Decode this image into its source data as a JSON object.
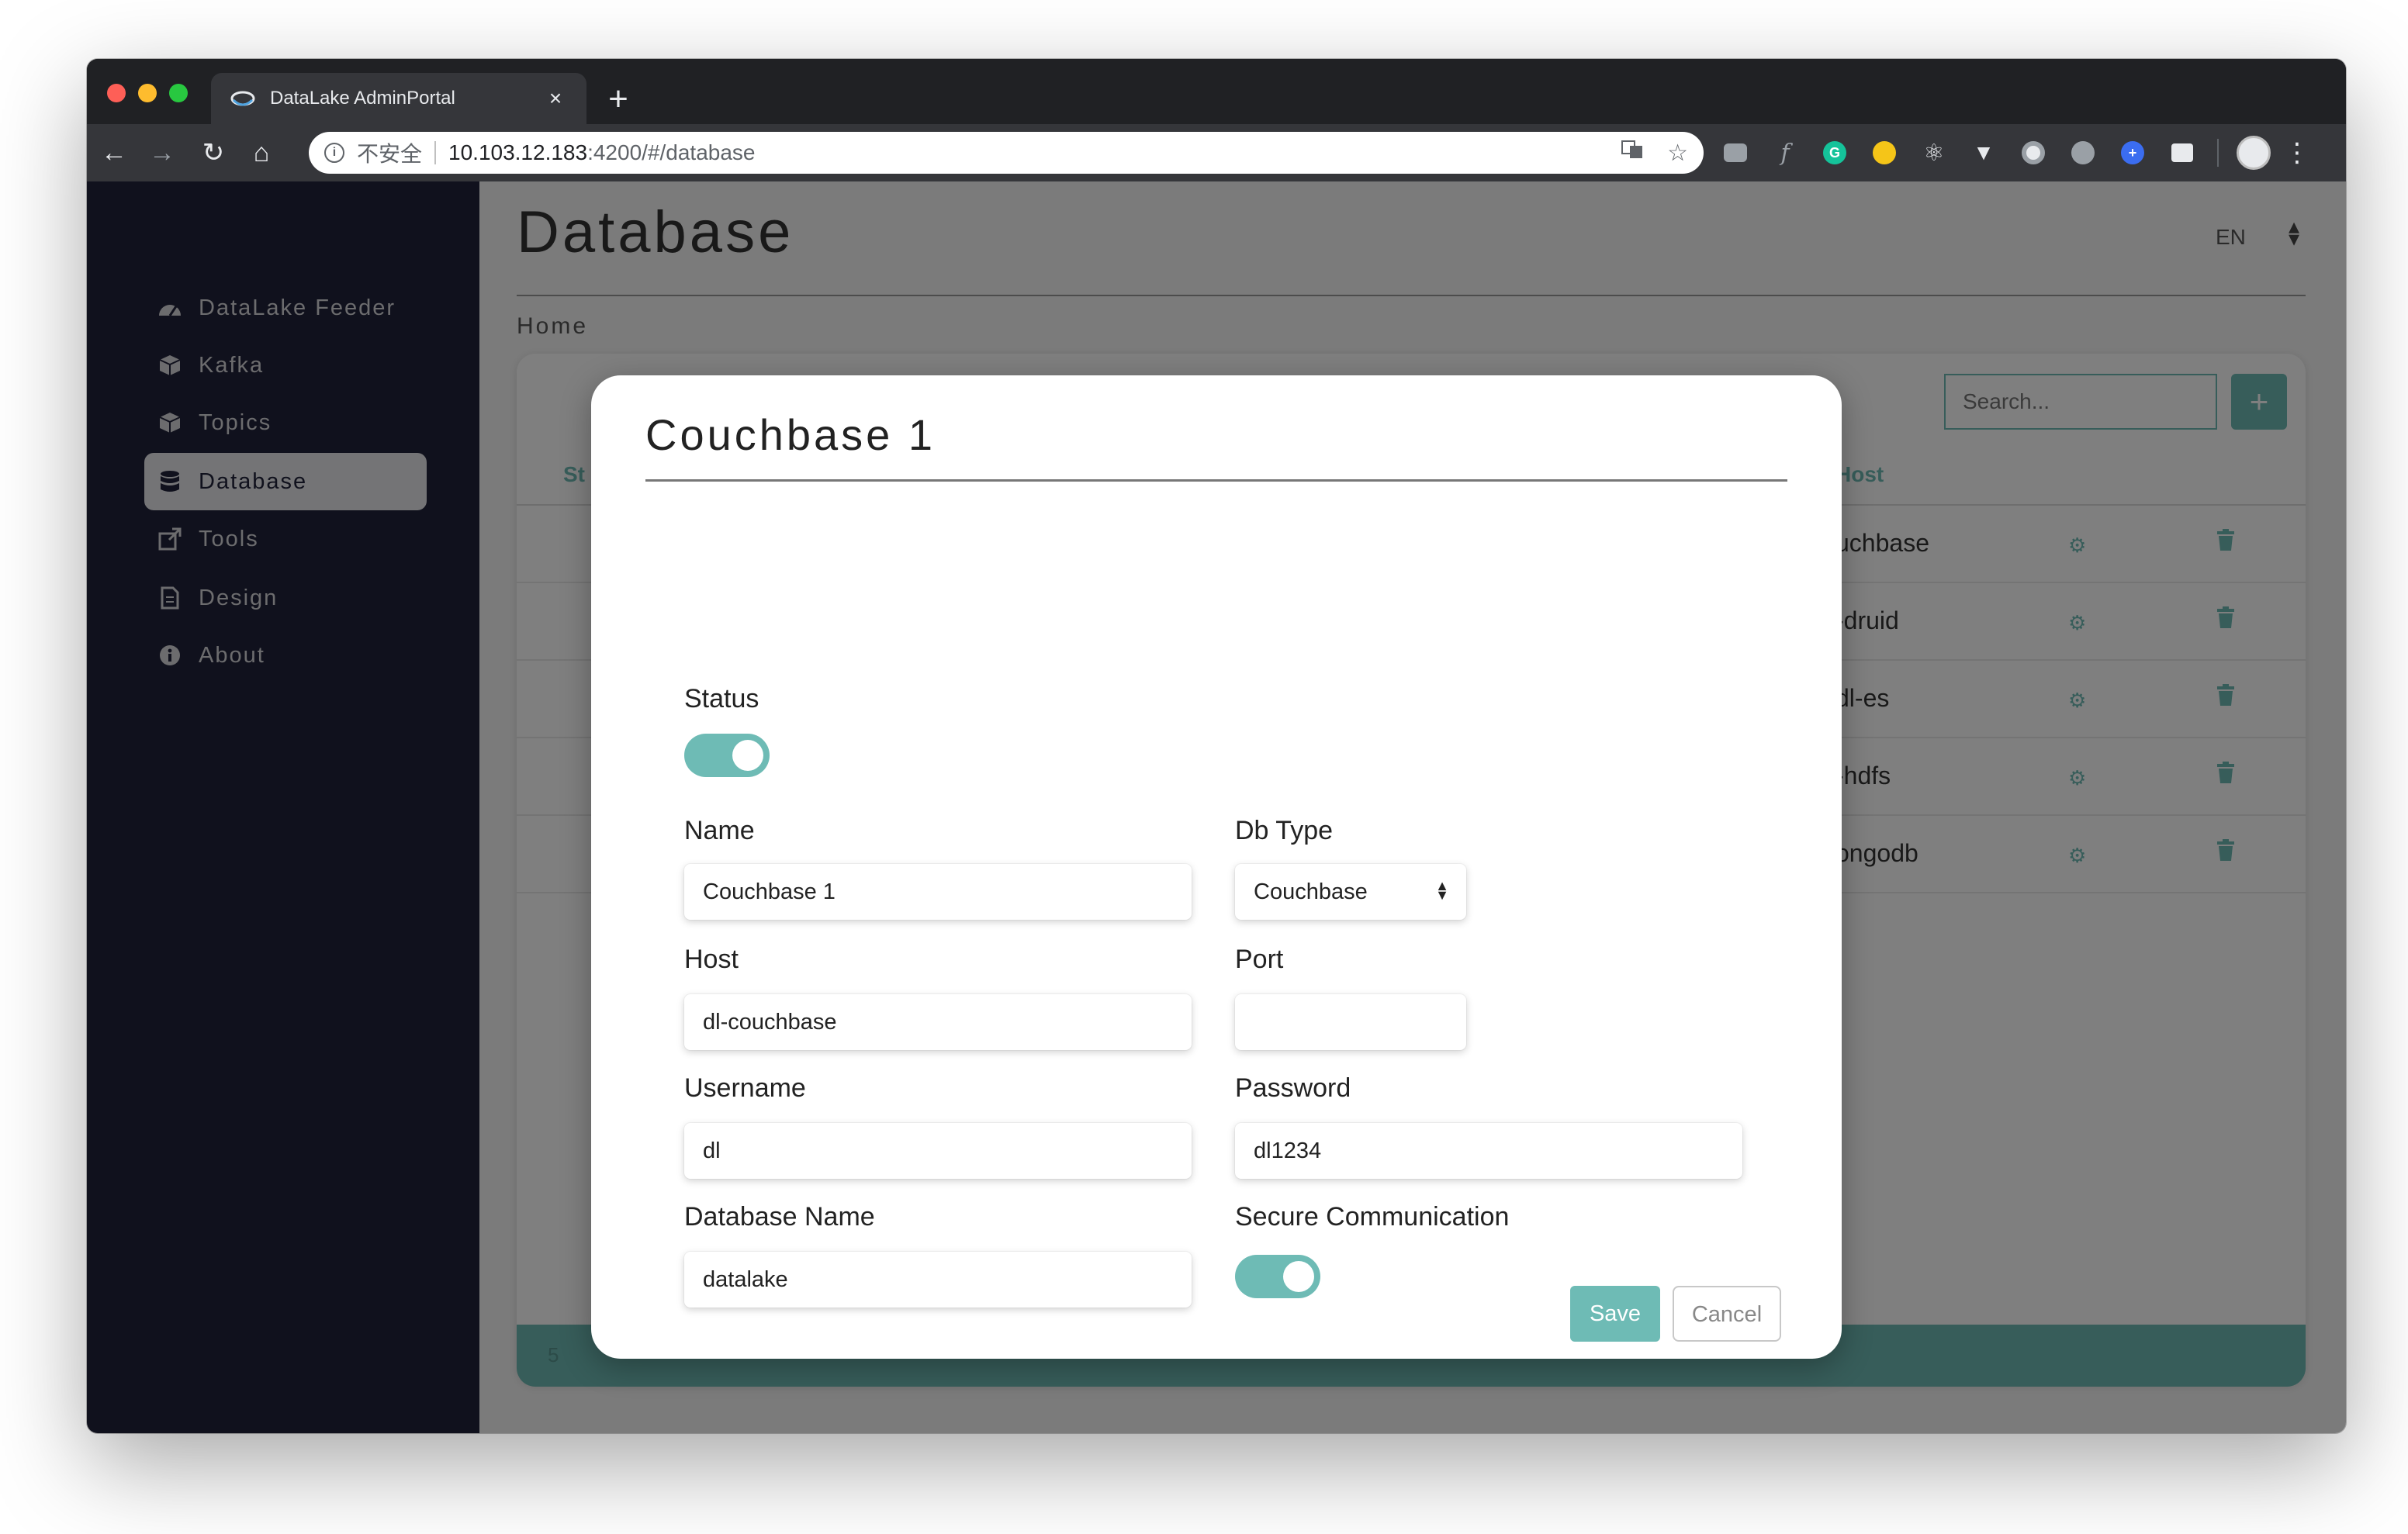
{
  "browser": {
    "tab_title": "DataLake AdminPortal",
    "tab_close": "×",
    "new_tab": "+",
    "security_label": "不安全",
    "url_host": "10.103.12.183",
    "url_path": ":4200/#/database"
  },
  "sidebar": {
    "items": [
      {
        "label": "DataLake Feeder",
        "icon": "dashboard-icon"
      },
      {
        "label": "Kafka",
        "icon": "cube-icon"
      },
      {
        "label": "Topics",
        "icon": "cube-icon"
      },
      {
        "label": "Database",
        "icon": "database-icon",
        "active": true
      },
      {
        "label": "Tools",
        "icon": "external-link-icon"
      },
      {
        "label": "Design",
        "icon": "file-icon"
      },
      {
        "label": "About",
        "icon": "info-icon"
      }
    ]
  },
  "page": {
    "title": "Database",
    "language": "EN",
    "breadcrumb": "Home",
    "search_placeholder": "Search...",
    "add_label": "+",
    "columns": {
      "status": "St",
      "host": "Host"
    },
    "rows": [
      {
        "host": "uchbase"
      },
      {
        "host": "-druid"
      },
      {
        "host": "dl-es"
      },
      {
        "host": "-hdfs"
      },
      {
        "host": "ongodb"
      }
    ],
    "footer_count": "5"
  },
  "modal": {
    "title": "Couchbase 1",
    "status_label": "Status",
    "status_on": true,
    "name_label": "Name",
    "name_value": "Couchbase 1",
    "dbtype_label": "Db Type",
    "dbtype_value": "Couchbase",
    "host_label": "Host",
    "host_value": "dl-couchbase",
    "port_label": "Port",
    "port_value": "",
    "username_label": "Username",
    "username_value": "dl",
    "password_label": "Password",
    "password_value": "dl1234",
    "dbname_label": "Database Name",
    "dbname_value": "datalake",
    "secure_label": "Secure Communication",
    "secure_on": true,
    "save_label": "Save",
    "cancel_label": "Cancel"
  },
  "colors": {
    "accent": "#6ebbb5",
    "sidebar_bg": "#20223a"
  }
}
